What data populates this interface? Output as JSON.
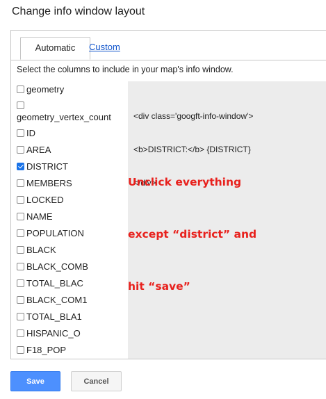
{
  "dialog": {
    "title": "Change info window layout"
  },
  "tabs": [
    {
      "label": "Automatic",
      "active": true
    },
    {
      "label": "Custom",
      "active": false
    }
  ],
  "instructions": "Select the columns to include in your map's info window.",
  "columns": [
    {
      "name": "geometry",
      "checked": false
    },
    {
      "name": "geometry_vertex_count",
      "checked": false
    },
    {
      "name": "ID",
      "checked": false
    },
    {
      "name": "AREA",
      "checked": false
    },
    {
      "name": "DISTRICT",
      "checked": true
    },
    {
      "name": "MEMBERS",
      "checked": false
    },
    {
      "name": "LOCKED",
      "checked": false
    },
    {
      "name": "NAME",
      "checked": false
    },
    {
      "name": "POPULATION",
      "checked": false
    },
    {
      "name": "BLACK",
      "checked": false
    },
    {
      "name": "BLACK_COMB",
      "checked": false
    },
    {
      "name": "TOTAL_BLAC",
      "checked": false
    },
    {
      "name": "BLACK_COM1",
      "checked": false
    },
    {
      "name": "TOTAL_BLA1",
      "checked": false
    },
    {
      "name": "HISPANIC_O",
      "checked": false
    },
    {
      "name": "F18_POP",
      "checked": false
    }
  ],
  "preview": {
    "code_lines": [
      "<div class='googft-info-window'>",
      "<b>DISTRICT:</b> {DISTRICT}",
      "</div>"
    ],
    "annotation_lines": [
      "Unclick everything",
      "except “district” and",
      "hit “save”"
    ],
    "annotation_color": "#e8211d"
  },
  "buttons": {
    "save_label": "Save",
    "cancel_label": "Cancel"
  },
  "colors": {
    "primary": "#4d90fe",
    "link": "#1155cc",
    "preview_bg": "#ececec"
  }
}
